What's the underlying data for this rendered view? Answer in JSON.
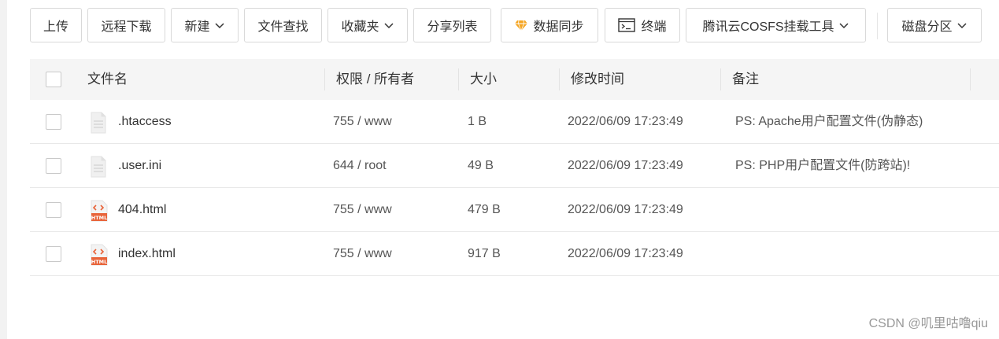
{
  "toolbar": {
    "upload": "上传",
    "remote_download": "远程下载",
    "new": "新建",
    "file_search": "文件查找",
    "favorites": "收藏夹",
    "share_list": "分享列表",
    "data_sync": "数据同步",
    "terminal": "终端",
    "cosfs_tool": "腾讯云COSFS挂载工具",
    "disk_partition": "磁盘分区"
  },
  "table": {
    "headers": {
      "name": "文件名",
      "permission": "权限 / 所有者",
      "size": "大小",
      "modified": "修改时间",
      "remark": "备注"
    },
    "rows": [
      {
        "name": ".htaccess",
        "icon": "text-file-icon",
        "permission": "755 / www",
        "size": "1 B",
        "modified": "2022/06/09 17:23:49",
        "remark": "PS: Apache用户配置文件(伪静态)"
      },
      {
        "name": ".user.ini",
        "icon": "text-file-icon",
        "permission": "644 / root",
        "size": "49 B",
        "modified": "2022/06/09 17:23:49",
        "remark": "PS: PHP用户配置文件(防跨站)!"
      },
      {
        "name": "404.html",
        "icon": "html-file-icon",
        "permission": "755 / www",
        "size": "479 B",
        "modified": "2022/06/09 17:23:49",
        "remark": ""
      },
      {
        "name": "index.html",
        "icon": "html-file-icon",
        "permission": "755 / www",
        "size": "917 B",
        "modified": "2022/06/09 17:23:49",
        "remark": ""
      }
    ]
  },
  "html_icon_label": "HTML",
  "watermark": "CSDN @叽里咕噜qiu",
  "colors": {
    "html_icon": "#e8643a",
    "gem_icon": "#f5a623",
    "header_bg": "#f5f5f5",
    "border": "#d9d9d9"
  }
}
